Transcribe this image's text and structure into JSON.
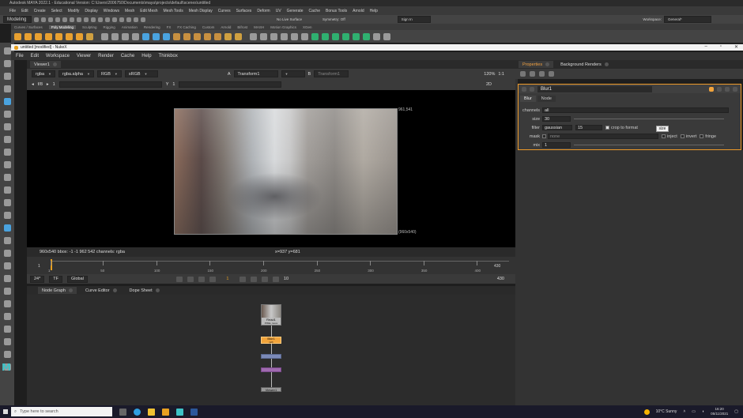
{
  "maya": {
    "title": "Autodesk MAYA 2022.1 - Educational Version: C:\\Users\\2006750\\Documents\\maya\\projects\\default\\scenes\\untitled",
    "menu": [
      "File",
      "Edit",
      "Create",
      "Select",
      "Modify",
      "Display",
      "Windows",
      "Mesh",
      "Edit Mesh",
      "Mesh Tools",
      "Mesh Display",
      "Curves",
      "Surfaces",
      "Deform",
      "UV",
      "Generate",
      "Cache",
      "Bonus Tools",
      "Arnold",
      "Help"
    ],
    "workspace_label": "Workspace:",
    "workspace_value": "General*",
    "mode_dropdown": "Modeling",
    "no_live_surface": "No Live Surface",
    "symmetry": "Symmetry: Off",
    "sign_in": "Sign In",
    "shelf_tabs": [
      "Curves / Surfaces",
      "Poly Modeling",
      "Sculpting",
      "Rigging",
      "Animation",
      "Rendering",
      "FX",
      "FX Caching",
      "Custom",
      "Arnold",
      "Bifrost",
      "MASH",
      "Motion Graphics",
      "XGen"
    ],
    "active_shelf_tab": "Poly Modeling",
    "logo": "M"
  },
  "nuke": {
    "window_title": "untitled [modified] - NukeX",
    "menu": [
      "File",
      "Edit",
      "Workspace",
      "Viewer",
      "Render",
      "Cache",
      "Help",
      "Thinkbox"
    ],
    "viewer": {
      "tab": "Viewer1",
      "channels": "rgba",
      "alpha": "rgba.alpha",
      "display": "RGB",
      "colorspace": "sRGB",
      "input_a": "Transform1",
      "input_b": "Transform1",
      "a_label": "A",
      "b_label": "B",
      "zoom": "120%",
      "ratio": "1:1",
      "mode": "2D",
      "fstop": "f/8",
      "gain_value": "1",
      "gamma_label": "Y",
      "gamma_value": "1",
      "size_top": "961,541",
      "size_bottom": "(960x540)",
      "info": "960x540  bbox: -1 -1 962 542 channels: rgba",
      "coords": "x=937 y=681"
    },
    "timeline": {
      "start": "1",
      "end": "430",
      "ticks": [
        "1",
        "50",
        "100",
        "150",
        "200",
        "250",
        "300",
        "350",
        "400"
      ],
      "fps": "24*",
      "tf": "TF",
      "global": "Global",
      "current_frame": "1",
      "step": "10",
      "end_frame": "430"
    },
    "graph_tabs": [
      "Node Graph",
      "Curve Editor",
      "Dope Sheet"
    ],
    "nodes": {
      "read": "Read1",
      "read_sub": "PIXEL moov",
      "blur": "Blur1",
      "blur_sub": "(all)",
      "viewer": "Viewer1"
    },
    "properties": {
      "tabs": [
        "Properties",
        "Background Renders"
      ],
      "node_name": "Blur1",
      "subtabs": [
        "Blur",
        "Node"
      ],
      "channels_label": "channels",
      "channels_value": "all",
      "size_label": "size",
      "size_value": "30",
      "filter_label": "filter",
      "filter_value": "gaussian",
      "quality_value": "15",
      "crop_label": "crop to format",
      "mask_label": "mask",
      "mask_value": "none",
      "inject_label": "inject",
      "invert_label": "invert",
      "fringe_label": "fringe",
      "mix_label": "mix",
      "mix_value": "1",
      "tooltip": "size"
    }
  },
  "taskbar": {
    "search_placeholder": "Type here to search",
    "weather": "10°C  Sunny",
    "time": "16:20",
    "date": "05/11/2021"
  },
  "colors": {
    "accent_orange": "#f0a040",
    "blur_node": "#f2a43c",
    "maya_cyan": "#3ec3c7"
  }
}
